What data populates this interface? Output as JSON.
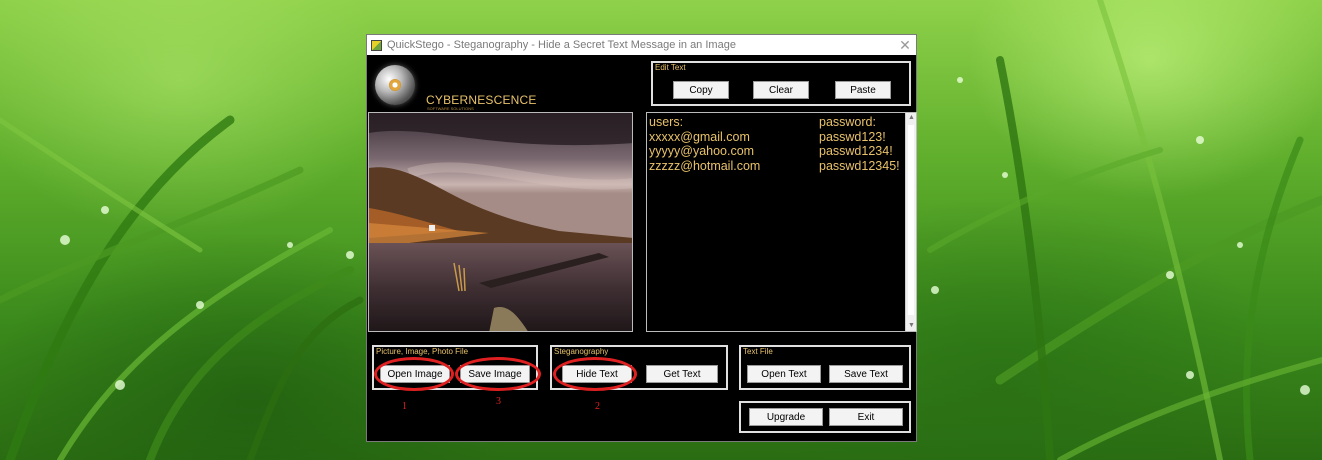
{
  "window": {
    "title": "QuickStego - Steganography - Hide a Secret Text Message in an Image",
    "close_glyph": "✕"
  },
  "brand": {
    "name": "CYBERNESCENCE",
    "tagline": "SOFTWARE SOLUTIONS"
  },
  "edit_text": {
    "label": "Edit Text",
    "copy": "Copy",
    "clear": "Clear",
    "paste": "Paste"
  },
  "secret_text": {
    "rows": [
      {
        "col1": "users:",
        "col2": "password:"
      },
      {
        "col1": "xxxxx@gmail.com",
        "col2": "passwd123!"
      },
      {
        "col1": "yyyyy@yahoo.com",
        "col2": "passwd1234!"
      },
      {
        "col1": "zzzzz@hotmail.com",
        "col2": "passwd12345!"
      }
    ]
  },
  "picture_file": {
    "label": "Picture, Image, Photo File",
    "open": "Open Image",
    "save": "Save Image"
  },
  "steganography": {
    "label": "Steganography",
    "hide": "Hide Text",
    "get": "Get Text"
  },
  "text_file": {
    "label": "Text File",
    "open": "Open Text",
    "save": "Save Text"
  },
  "bottom": {
    "upgrade": "Upgrade",
    "exit": "Exit"
  },
  "annotations": {
    "one": "1",
    "two": "2",
    "three": "3"
  },
  "colors": {
    "accent_text": "#e8c26a",
    "annotation": "#e02020",
    "window_bg": "#000000"
  }
}
